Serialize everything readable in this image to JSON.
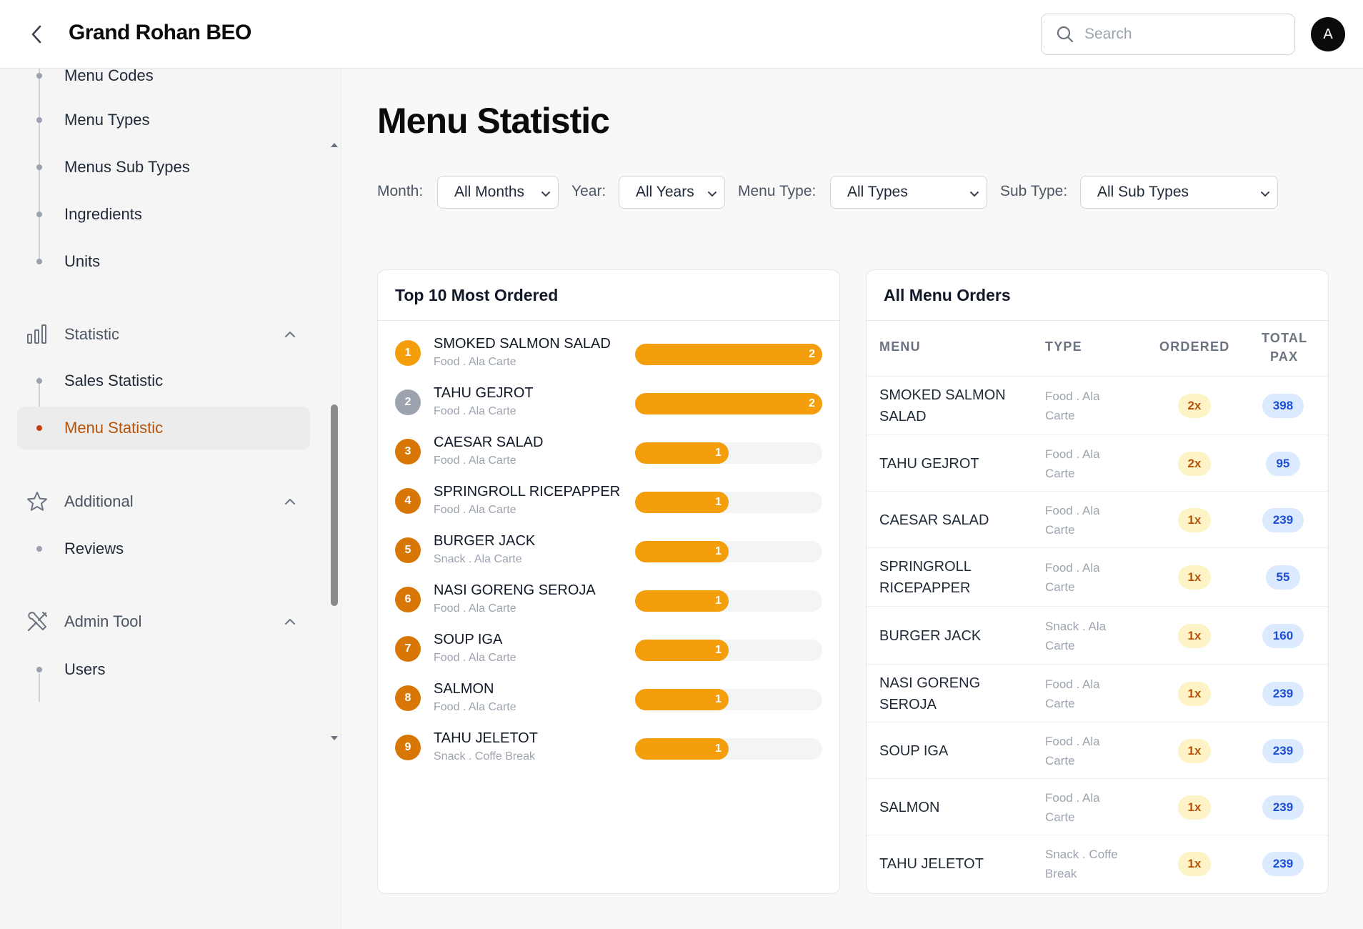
{
  "header": {
    "title": "Grand Rohan BEO",
    "search_placeholder": "Search",
    "avatar_initial": "A"
  },
  "sidebar": {
    "settings_items": [
      {
        "label": "Menu Codes"
      },
      {
        "label": "Menu Types"
      },
      {
        "label": "Menus Sub Types"
      },
      {
        "label": "Ingredients"
      },
      {
        "label": "Units"
      }
    ],
    "statistic_group": {
      "label": "Statistic",
      "icon": "bar-chart-icon",
      "items": [
        {
          "label": "Sales Statistic",
          "active": false
        },
        {
          "label": "Menu Statistic",
          "active": true
        }
      ]
    },
    "additional_group": {
      "label": "Additional",
      "icon": "star-icon",
      "items": [
        {
          "label": "Reviews"
        }
      ]
    },
    "admin_group": {
      "label": "Admin Tool",
      "icon": "tools-icon",
      "items": [
        {
          "label": "Users"
        }
      ]
    }
  },
  "main": {
    "title": "Menu Statistic",
    "filters": {
      "month_label": "Month:",
      "month_value": "All Months",
      "year_label": "Year:",
      "year_value": "All Years",
      "menu_type_label": "Menu Type:",
      "menu_type_value": "All Types",
      "sub_type_label": "Sub Type:",
      "sub_type_value": "All Sub Types"
    },
    "top_card": {
      "title": "Top 10 Most Ordered",
      "max_count": 2,
      "items": [
        {
          "rank": "1",
          "name": "SMOKED SALMON SALAD",
          "sub": "Food . Ala Carte",
          "count": 2,
          "count_label": "2"
        },
        {
          "rank": "2",
          "name": "TAHU GEJROT",
          "sub": "Food . Ala Carte",
          "count": 2,
          "count_label": "2"
        },
        {
          "rank": "3",
          "name": "CAESAR SALAD",
          "sub": "Food . Ala Carte",
          "count": 1,
          "count_label": "1"
        },
        {
          "rank": "4",
          "name": "SPRINGROLL RICEPAPPER",
          "sub": "Food . Ala Carte",
          "count": 1,
          "count_label": "1"
        },
        {
          "rank": "5",
          "name": "BURGER JACK",
          "sub": "Snack . Ala Carte",
          "count": 1,
          "count_label": "1"
        },
        {
          "rank": "6",
          "name": "NASI GORENG SEROJA",
          "sub": "Food . Ala Carte",
          "count": 1,
          "count_label": "1"
        },
        {
          "rank": "7",
          "name": "SOUP IGA",
          "sub": "Food . Ala Carte",
          "count": 1,
          "count_label": "1"
        },
        {
          "rank": "8",
          "name": "SALMON",
          "sub": "Food . Ala Carte",
          "count": 1,
          "count_label": "1"
        },
        {
          "rank": "9",
          "name": "TAHU JELETOT",
          "sub": "Snack . Coffe Break",
          "count": 1,
          "count_label": "1"
        }
      ]
    },
    "orders_card": {
      "title": "All Menu Orders",
      "columns": [
        "MENU",
        "TYPE",
        "ORDERED",
        "TOTAL",
        "PAX"
      ],
      "rows": [
        {
          "menu": [
            "SMOKED SALMON",
            "SALAD"
          ],
          "type": [
            "Food . Ala",
            "Carte"
          ],
          "ordered": "2x",
          "pax": "398"
        },
        {
          "menu": [
            "TAHU GEJROT"
          ],
          "type": [
            "Food . Ala",
            "Carte"
          ],
          "ordered": "2x",
          "pax": "95"
        },
        {
          "menu": [
            "CAESAR SALAD"
          ],
          "type": [
            "Food . Ala",
            "Carte"
          ],
          "ordered": "1x",
          "pax": "239"
        },
        {
          "menu": [
            "SPRINGROLL",
            "RICEPAPPER"
          ],
          "type": [
            "Food . Ala",
            "Carte"
          ],
          "ordered": "1x",
          "pax": "55"
        },
        {
          "menu": [
            "BURGER JACK"
          ],
          "type": [
            "Snack . Ala",
            "Carte"
          ],
          "ordered": "1x",
          "pax": "160"
        },
        {
          "menu": [
            "NASI GORENG",
            "SEROJA"
          ],
          "type": [
            "Food . Ala",
            "Carte"
          ],
          "ordered": "1x",
          "pax": "239"
        },
        {
          "menu": [
            "SOUP IGA"
          ],
          "type": [
            "Food . Ala",
            "Carte"
          ],
          "ordered": "1x",
          "pax": "239"
        },
        {
          "menu": [
            "SALMON"
          ],
          "type": [
            "Food . Ala",
            "Carte"
          ],
          "ordered": "1x",
          "pax": "239"
        },
        {
          "menu": [
            "TAHU JELETOT"
          ],
          "type": [
            "Snack . Coffe",
            "Break"
          ],
          "ordered": "1x",
          "pax": "239"
        }
      ]
    }
  },
  "colors": {
    "accent_orange": "#f59e0b",
    "rank_gold": "#f59e0b",
    "rank_silver": "#9ca3af",
    "rank_bronze": "#d97706",
    "active_text": "#b45309"
  }
}
